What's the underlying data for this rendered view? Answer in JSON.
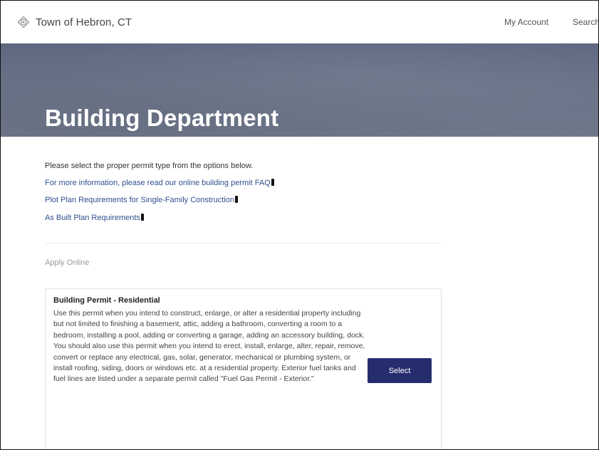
{
  "header": {
    "site_name": "Town of Hebron, CT",
    "nav": {
      "my_account": "My Account",
      "search": "Search"
    },
    "logo_icon": "town-seal-icon"
  },
  "hero": {
    "title": "Building Department"
  },
  "intro": {
    "instruction": "Please select the proper permit type from the options below.",
    "links": [
      "For more information, please read our online building permit FAQ",
      "Plot Plan Requirements for Single-Family Construction",
      "As Built Plan Requirements"
    ]
  },
  "apply": {
    "section_label": "Apply Online",
    "permits": [
      {
        "title": "Building Permit - Residential",
        "description": "Use this permit when you intend to construct, enlarge, or alter a residential property including but not limited to finishing a basement, attic, adding a bathroom, converting a room to a bedroom, installing a pool, adding or converting a garage, adding an accessory building, dock. You should also use this permit when you intend to erect, install, enlarge, alter, repair, remove, convert or replace any electrical, gas, solar, generator, mechanical or plumbing system, or install roofing, siding, doors or windows etc. at a residential property. Exterior fuel tanks and fuel lines are listed under a separate permit called \"Fuel Gas Permit - Exterior.\"",
        "button_label": "Select"
      }
    ]
  },
  "colors": {
    "hero_bg": "#6a7388",
    "link": "#2f4f8f",
    "button_bg": "#262d6e"
  }
}
